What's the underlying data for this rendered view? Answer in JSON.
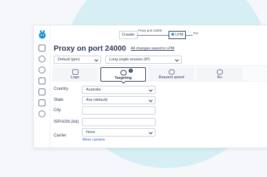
{
  "pipeline": {
    "crawler_label": "Crawler",
    "proxy_label": "Proxy port 24000",
    "lpm_label": "LPM",
    "next_label": "Por"
  },
  "header": {
    "title": "Proxy on port 24000",
    "saved_link": "All changes saved in LPM"
  },
  "selects": {
    "preset": "Default (gen)",
    "session": "Long single session (IP)"
  },
  "tabs": [
    {
      "label": "Logs",
      "icon": "logs-icon"
    },
    {
      "label": "Targeting",
      "icon": "target-icon",
      "badge": "1",
      "active": true
    },
    {
      "label": "Request speed",
      "icon": "speed-icon"
    },
    {
      "label": "Ru",
      "icon": "rules-icon"
    }
  ],
  "form": {
    "country_label": "Country",
    "country_value": "Australia",
    "state_label": "State",
    "state_value": "Any (default)",
    "city_label": "City",
    "city_value": "",
    "isp_label": "ISP/ASN (list)",
    "isp_value": "",
    "carrier_label": "Carrier",
    "carrier_value": "None",
    "more_carriers": "More carriers"
  },
  "colors": {
    "navy": "#2b3a55",
    "accent": "#1e93d4",
    "bg_circle": "#d6eff5"
  }
}
